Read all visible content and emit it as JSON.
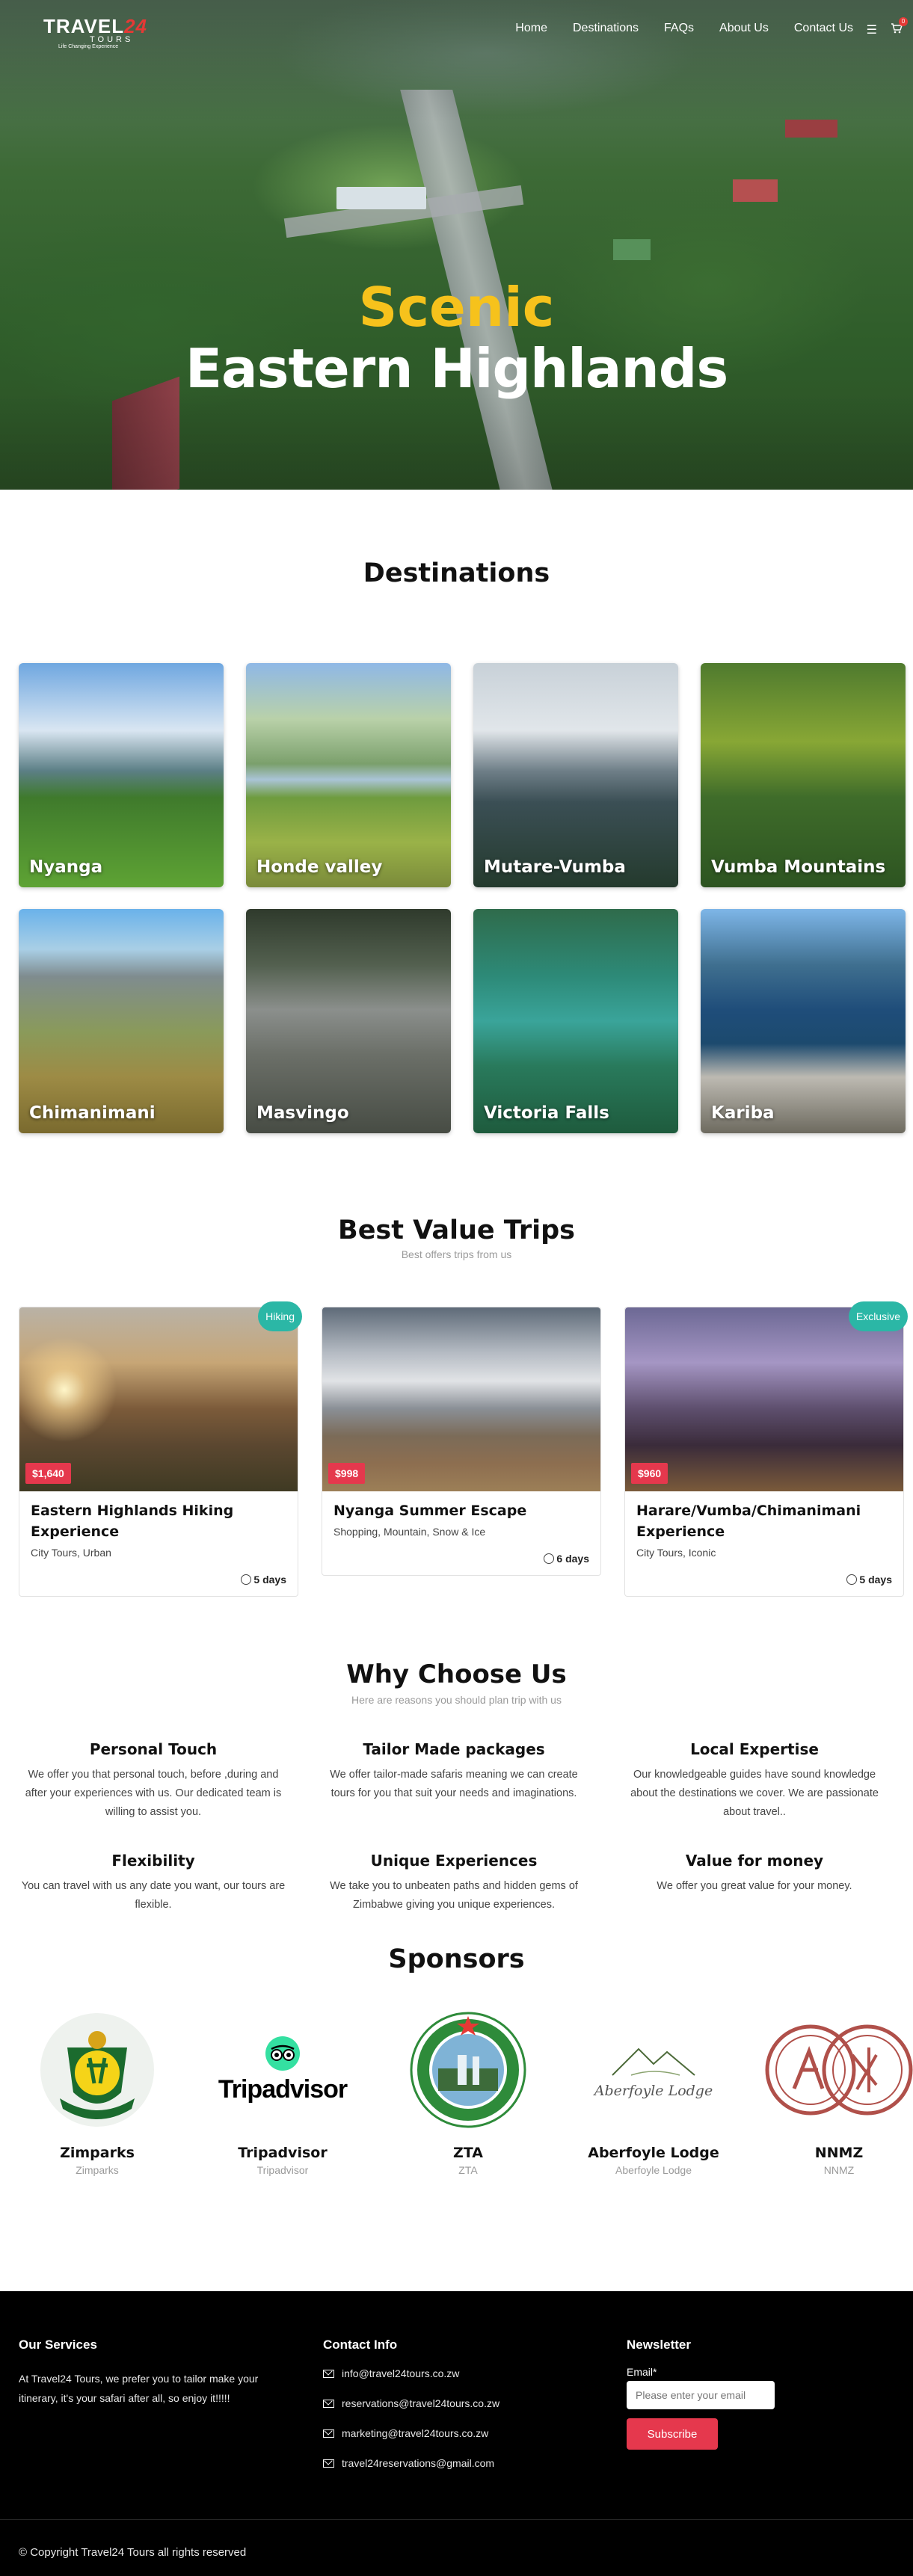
{
  "nav": {
    "logo_main": "TRAVEL",
    "logo_num": "24",
    "logo_sub": "TOURS",
    "logo_tagline": "Life Changing Experience",
    "items": [
      "Home",
      "Destinations",
      "FAQs",
      "About Us",
      "Contact Us"
    ],
    "cart_count": "0"
  },
  "hero": {
    "line1": "Scenic",
    "line2": "Eastern Highlands"
  },
  "destinations": {
    "title": "Destinations",
    "items": [
      "Nyanga",
      "Honde valley",
      "Mutare-Vumba",
      "Vumba Mountains",
      "Chimanimani",
      "Masvingo",
      "Victoria Falls",
      "Kariba"
    ]
  },
  "trips": {
    "title": "Best Value Trips",
    "subtitle": "Best offers trips from us",
    "items": [
      {
        "badge": "Hiking",
        "price": "$1,640",
        "title": "Eastern Highlands Hiking Experience",
        "tags": "City Tours, Urban",
        "days": "5 days"
      },
      {
        "badge": "",
        "price": "$998",
        "title": "Nyanga Summer Escape",
        "tags": "Shopping, Mountain, Snow & Ice",
        "days": "6 days"
      },
      {
        "badge": "Exclusive",
        "price": "$960",
        "title": "Harare/Vumba/Chimanimani Experience",
        "tags": "City Tours, Iconic",
        "days": "5 days"
      }
    ]
  },
  "why": {
    "title": "Why Choose Us",
    "subtitle": "Here are reasons you should plan trip with us",
    "items": [
      {
        "title": "Personal Touch",
        "text": "We offer you that personal touch, before ,during and after your experiences with us. Our dedicated team is willing to assist you."
      },
      {
        "title": "Tailor Made packages",
        "text": "We offer tailor-made safaris meaning we can create tours for you that suit your needs and imaginations."
      },
      {
        "title": "Local Expertise",
        "text": "Our knowledgeable guides have sound knowledge about the destinations we cover. We are passionate about travel.."
      },
      {
        "title": "Flexibility",
        "text": "You can travel with us any date you want, our tours are flexible."
      },
      {
        "title": "Unique Experiences",
        "text": "We take you to unbeaten paths and hidden gems of Zimbabwe giving you unique experiences."
      },
      {
        "title": "Value for money",
        "text": "We offer you great value for your money."
      }
    ]
  },
  "sponsors": {
    "title": "Sponsors",
    "items": [
      {
        "name": "Zimparks",
        "sub": "Zimparks",
        "logo_text": ""
      },
      {
        "name": "Tripadvisor",
        "sub": "Tripadvisor",
        "logo_text": "Tripadvisor"
      },
      {
        "name": "ZTA",
        "sub": "ZTA",
        "logo_text": "ZIMBABWE TOURISM AUTHORITY"
      },
      {
        "name": "Aberfoyle Lodge",
        "sub": "Aberfoyle Lodge",
        "logo_text": "Aberfoyle Lodge"
      },
      {
        "name": "NNMZ",
        "sub": "NNMZ",
        "logo_text": ""
      }
    ]
  },
  "footer": {
    "services_title": "Our Services",
    "services_text": "At Travel24 Tours, we prefer you to tailor make your itinerary, it's your safari after all, so enjoy it!!!!!",
    "contact_title": "Contact Info",
    "emails": [
      "info@travel24tours.co.zw",
      "reservations@travel24tours.co.zw",
      "marketing@travel24tours.co.zw",
      "travel24reservations@gmail.com"
    ],
    "newsletter_title": "Newsletter",
    "email_label": "Email*",
    "email_placeholder": "Please enter your email",
    "subscribe": "Subscribe",
    "copyright": "© Copyright Travel24 Tours all rights reserved"
  },
  "colors": {
    "accent_red": "#e5384d",
    "accent_teal": "#2bb7a6",
    "hero_yellow": "#f6c21c"
  }
}
